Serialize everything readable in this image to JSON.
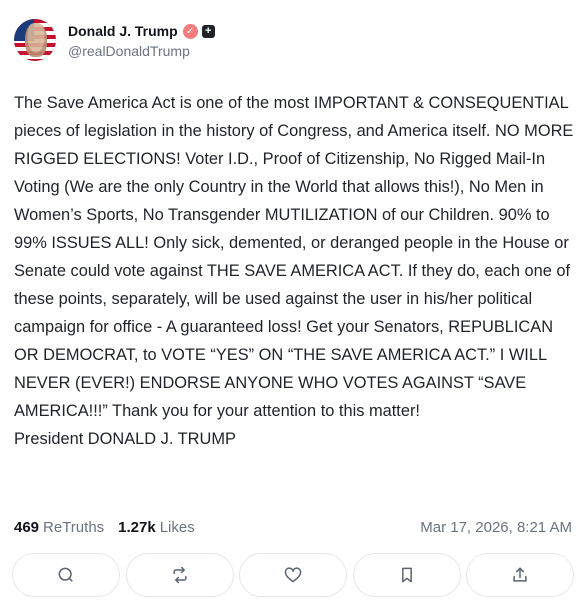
{
  "author": {
    "display_name": "Donald J. Trump",
    "handle": "@realDonaldTrump",
    "verified_icon": "verified-badge-icon",
    "extra_badge_icon": "plus-badge-icon"
  },
  "post": {
    "text": "The Save America Act is one of the most IMPORTANT & CONSEQUENTIAL pieces of legislation in the history of Congress, and America itself. NO MORE RIGGED ELECTIONS! Voter I.D., Proof of Citizenship, No Rigged Mail-In Voting (We are the only Country in the World that allows this!), No Men in Women’s Sports, No Transgender MUTILIZATION of our Children. 90% to 99% ISSUES ALL! Only sick, demented, or deranged people in the House or Senate could vote against THE SAVE AMERICA ACT. If they do, each one of these points, separately, will be used against the user in his/her political campaign for office - A guaranteed loss! Get your Senators, REPUBLICAN OR DEMOCRAT, to VOTE “YES” ON “THE SAVE AMERICA ACT.” I WILL NEVER (EVER!) ENDORSE ANYONE WHO VOTES AGAINST “SAVE AMERICA!!!” Thank you for your attention to this matter!\nPresident DONALD J. TRUMP"
  },
  "stats": {
    "retruths_count": "469",
    "retruths_label": "ReTruths",
    "likes_count": "1.27k",
    "likes_label": "Likes",
    "timestamp": "Mar 17, 2026, 8:21 AM"
  },
  "actions": [
    {
      "name": "reply-button",
      "icon": "reply-icon"
    },
    {
      "name": "retruth-button",
      "icon": "retruth-icon"
    },
    {
      "name": "like-button",
      "icon": "heart-icon"
    },
    {
      "name": "bookmark-button",
      "icon": "bookmark-icon"
    },
    {
      "name": "share-button",
      "icon": "share-icon"
    }
  ],
  "colors": {
    "verified_badge": "#f47c7c",
    "text": "#1f2328",
    "muted": "#6b7280",
    "border": "#e5e7eb"
  }
}
